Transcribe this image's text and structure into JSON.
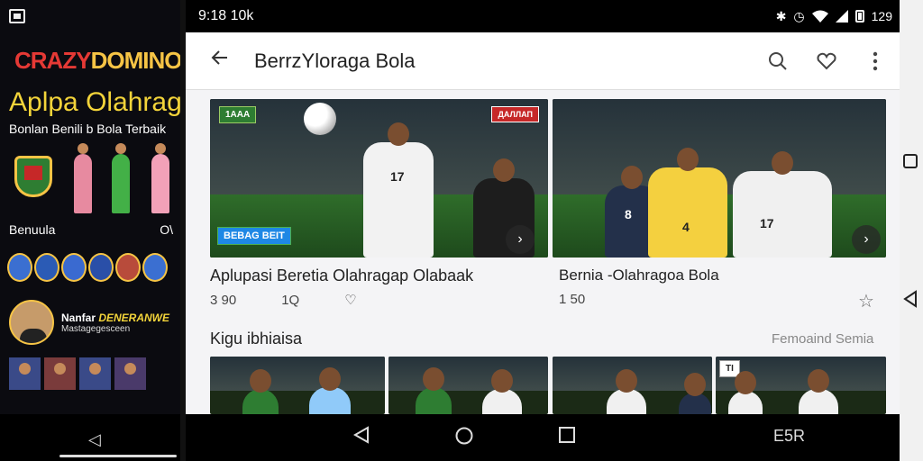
{
  "left_panel": {
    "brand_part1": "CRAZY",
    "brand_part2": "DOMINO",
    "title": "Aplpa Olahrag",
    "subtitle": "Bonlan Benili b Bola Terbaik",
    "row_left": "Benuula",
    "row_right": "O\\",
    "promo_title_plain": "Nanfar ",
    "promo_title_accent": "DENERANWE",
    "promo_subtitle": "Mastagegesceen"
  },
  "status_bar": {
    "time": "9:18 10k",
    "battery_text": "129"
  },
  "app_bar": {
    "title": "BerrzYloraga Bola",
    "back_icon": "arrow-left-icon",
    "actions": [
      "search-icon",
      "heart-icon",
      "more-vert-icon"
    ]
  },
  "featured": [
    {
      "caption": "Aplupasi Beretia Olahragap Olabaak",
      "views": "3 90",
      "count": "1Q",
      "badge_top": "1AAA",
      "logo_text": "ДАЛЛАП",
      "banner_text": "BEBAG BEIT",
      "jersey_number": "17"
    },
    {
      "caption": "Bernia -Olahragoa Bola",
      "views": "1 50",
      "jersey_numbers": [
        "8",
        "4",
        "17"
      ]
    }
  ],
  "section": {
    "title": "Kigu ibhiaisa",
    "see_all": "Femoaind Semia",
    "tag": "TI"
  },
  "navbar_extra": "E5R"
}
